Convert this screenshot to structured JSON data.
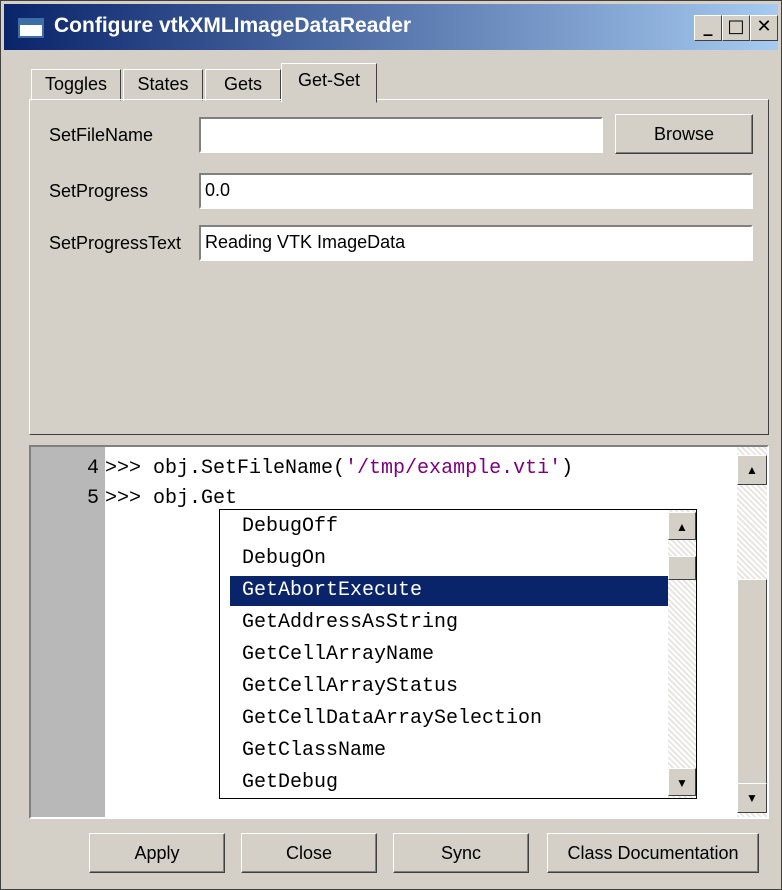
{
  "window": {
    "title": "Configure vtkXMLImageDataReader",
    "controls": {
      "minimize": "_",
      "maximize": "□",
      "close": "✕"
    }
  },
  "tabs": [
    {
      "label": "Toggles",
      "active": false
    },
    {
      "label": "States",
      "active": false
    },
    {
      "label": "Gets",
      "active": false
    },
    {
      "label": "Get-Set",
      "active": true
    }
  ],
  "form": {
    "filename": {
      "label": "SetFileName",
      "value": ""
    },
    "browse_label": "Browse",
    "progress": {
      "label": "SetProgress",
      "value": "0.0"
    },
    "progress_text": {
      "label": "SetProgressText",
      "value": "Reading VTK ImageData"
    }
  },
  "console": {
    "lines": [
      {
        "num": "4",
        "prompt": ">>> ",
        "code": "obj.SetFileName(",
        "string": "'/tmp/example.vti'",
        "suffix": ")"
      },
      {
        "num": "5",
        "prompt": ">>> ",
        "code": "obj.Get",
        "string": "",
        "suffix": ""
      }
    ]
  },
  "autocomplete": {
    "items": [
      "DebugOff",
      "DebugOn",
      "GetAbortExecute",
      "GetAddressAsString",
      "GetCellArrayName",
      "GetCellArrayStatus",
      "GetCellDataArraySelection",
      "GetClassName",
      "GetDebug"
    ],
    "selected": "GetAbortExecute"
  },
  "buttons": {
    "apply": "Apply",
    "close": "Close",
    "sync": "Sync",
    "docs": "Class Documentation"
  }
}
